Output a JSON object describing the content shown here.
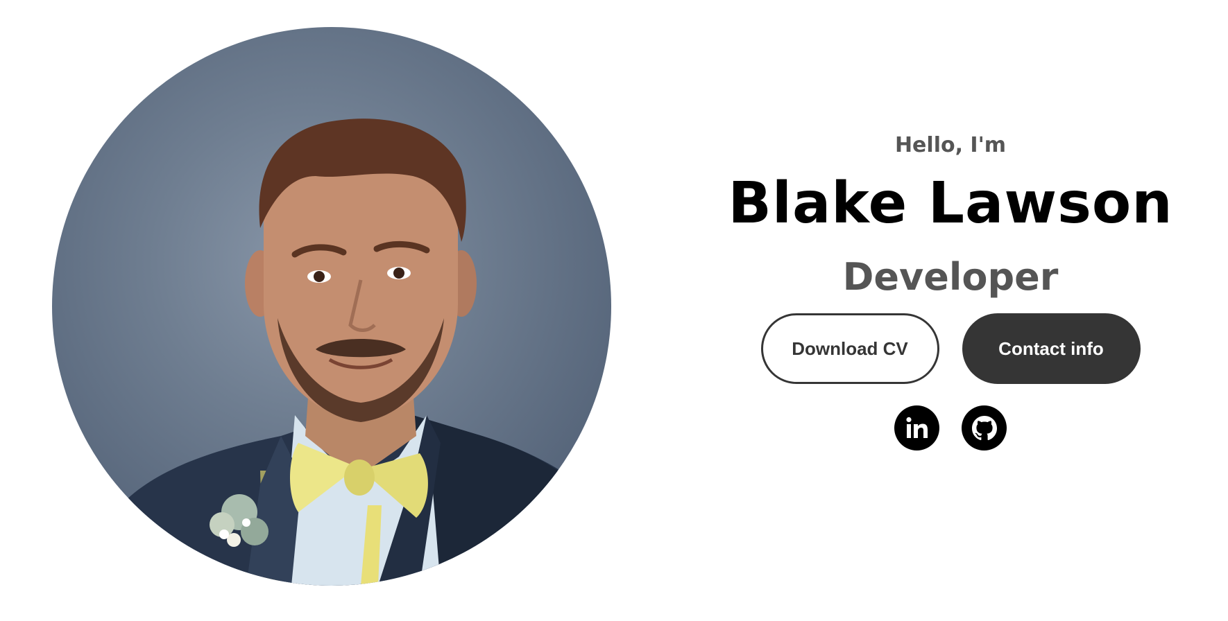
{
  "profile": {
    "photo_icon": "profile-photo"
  },
  "intro": {
    "greeting": "Hello, I'm",
    "name": "Blake Lawson",
    "role": "Developer"
  },
  "buttons": {
    "download_cv": "Download CV",
    "contact_info": "Contact info"
  },
  "socials": [
    {
      "icon": "linkedin-icon",
      "label": "in"
    },
    {
      "icon": "github-icon"
    }
  ],
  "colors": {
    "text_primary": "#000000",
    "text_secondary": "#555555",
    "button_dark": "#353535",
    "photo_background": "#6f7e91"
  }
}
